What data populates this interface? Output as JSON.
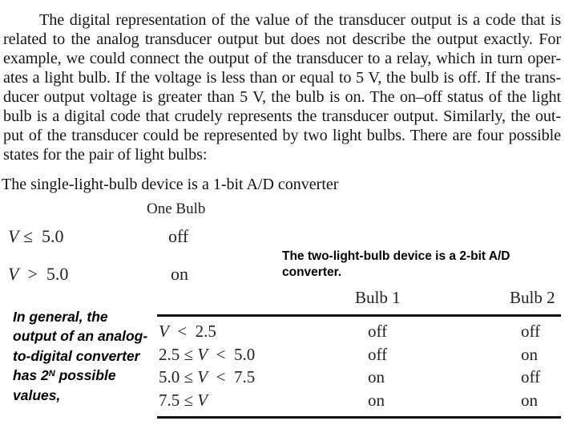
{
  "paragraph": {
    "lines": [
      "The digital representation of the value of the transducer output is a code that is",
      "related to the analog transducer output but does not describe the output exactly. For",
      "example, we could connect the output of the transducer to a relay, which in turn oper-",
      "ates a light bulb. If the voltage is less than or equal to 5 V, the bulb is off. If the trans-",
      "ducer output voltage is greater than 5 V, the bulb is on. The on–off status of the light",
      "bulb is a digital code that crudely represents the transducer output. Similarly, the out-",
      "put of the transducer could be represented by two light bulbs. There are four possible",
      "states for the pair of light bulbs:"
    ]
  },
  "single_bulb": {
    "heading": "The single-light-bulb device is a 1-bit A/D converter",
    "column_header": "One Bulb",
    "rows": [
      {
        "variable": "V",
        "relation": " ≤  5.0",
        "state": "off"
      },
      {
        "variable": "V",
        "relation": "  >  5.0",
        "state": "on"
      }
    ]
  },
  "two_bulb": {
    "heading": "The two-light-bulb device is a 2-bit A/D converter.",
    "column_headers": [
      "Bulb 1",
      "Bulb 2"
    ],
    "rows": [
      {
        "pre": "",
        "variable": "V",
        "post": "  <  2.5",
        "bulb1": "off",
        "bulb2": "off"
      },
      {
        "pre": "2.5 ≤ ",
        "variable": "V",
        "post": "  <  5.0",
        "bulb1": "off",
        "bulb2": "on"
      },
      {
        "pre": "5.0 ≤ ",
        "variable": "V",
        "post": "  <  7.5",
        "bulb1": "on",
        "bulb2": "off"
      },
      {
        "pre": "7.5 ≤ ",
        "variable": "V",
        "post": "",
        "bulb1": "on",
        "bulb2": "on"
      }
    ]
  },
  "general_note": {
    "text_before": "In general, the output of an analog-to-digital converter has ",
    "base": "2",
    "exponent": "N",
    "text_after": " possible values,"
  }
}
